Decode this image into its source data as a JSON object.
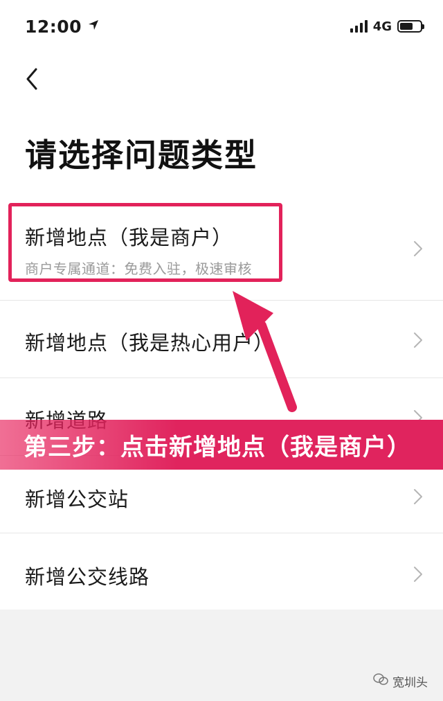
{
  "status_bar": {
    "time": "12:00",
    "network": "4G",
    "signal_bars": 4,
    "battery_level": 0.65
  },
  "header": {
    "back_icon": "chevron-left-icon",
    "title": "请选择问题类型"
  },
  "list": {
    "items": [
      {
        "label": "新增地点（我是商户）",
        "subtitle": "商户专属通道：免费入驻，极速审核"
      },
      {
        "label": "新增地点（我是热心用户）"
      },
      {
        "label": "新增道路"
      },
      {
        "label": "新增公交站"
      },
      {
        "label": "新增公交线路"
      }
    ],
    "chevron_icon": "chevron-right-icon"
  },
  "annotation": {
    "banner_text": "第三步：点击新增地点（我是商户）",
    "color": "#e2225a"
  },
  "watermark": {
    "icon": "wechat-icon",
    "text": "宽圳头"
  }
}
